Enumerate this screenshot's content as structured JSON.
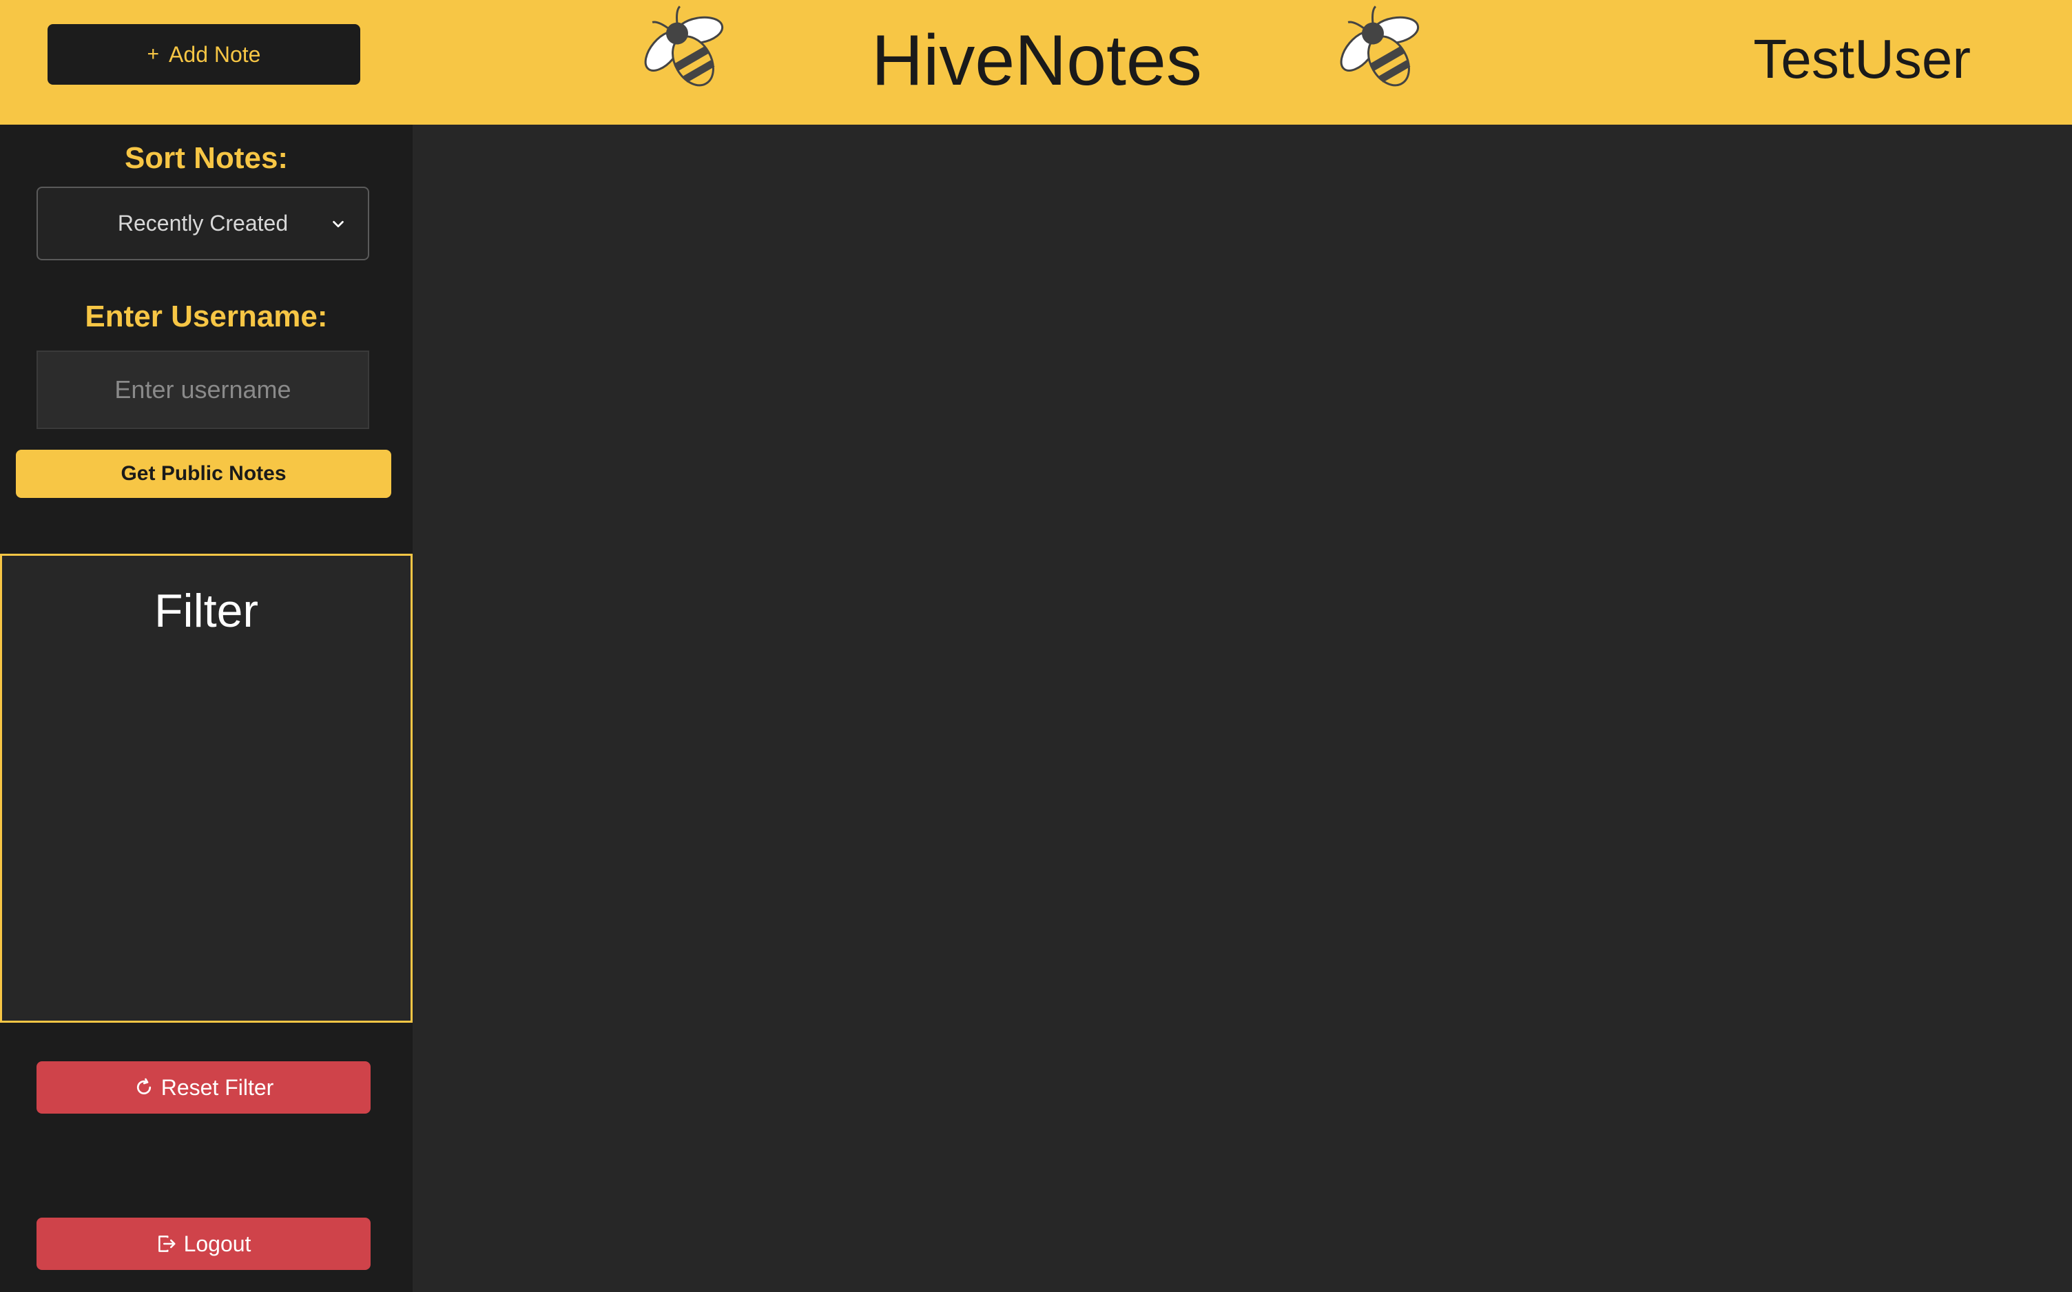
{
  "header": {
    "add_note_label": "Add Note",
    "app_title": "HiveNotes",
    "current_user": "TestUser"
  },
  "sidebar": {
    "sort_label": "Sort Notes:",
    "sort_selected": "Recently Created",
    "username_label": "Enter Username:",
    "username_placeholder": "Enter username",
    "username_value": "",
    "public_notes_label": "Get Public Notes",
    "filter_title": "Filter",
    "reset_filter_label": "Reset Filter",
    "logout_label": "Logout"
  },
  "icons": {
    "add": "plus-icon",
    "logo": "bee-icon",
    "sort_dropdown": "chevron-down-icon",
    "reset": "refresh-icon",
    "logout": "logout-icon"
  },
  "colors": {
    "accent": "#F7C645",
    "danger": "#CF434A",
    "sidebar_bg": "#1C1C1C",
    "main_bg": "#272727"
  }
}
